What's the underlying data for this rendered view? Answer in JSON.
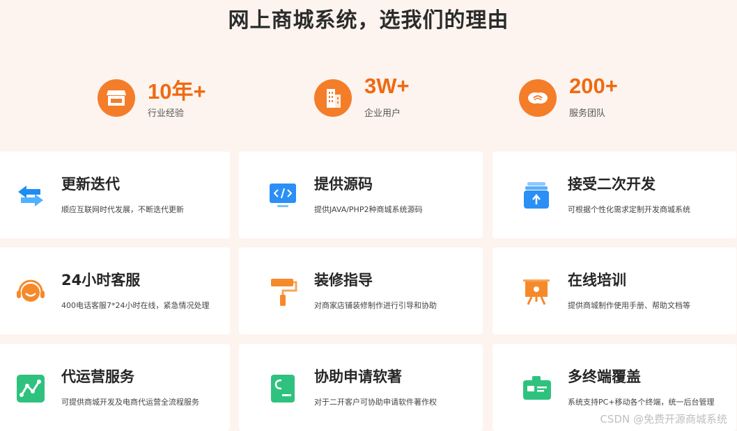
{
  "header": {
    "title": "网上商城系统，选我们的理由"
  },
  "stats": [
    {
      "number": "10年+",
      "label": "行业经验",
      "icon": "store-icon"
    },
    {
      "number": "3W+",
      "label": "企业用户",
      "icon": "building-icon"
    },
    {
      "number": "200+",
      "label": "服务团队",
      "icon": "handshake-icon"
    }
  ],
  "features": [
    {
      "title": "更新迭代",
      "desc": "顺应互联网时代发展，不断迭代更新",
      "icon": "swap-arrows-icon"
    },
    {
      "title": "提供源码",
      "desc": "提供JAVA/PHP2种商城系统源码",
      "icon": "code-monitor-icon"
    },
    {
      "title": "接受二次开发",
      "desc": "可根据个性化需求定制开发商城系统",
      "icon": "upload-box-icon"
    },
    {
      "title": "24小时客服",
      "desc": "400电话客服7*24小时在线，紧急情况处理",
      "icon": "headset-icon"
    },
    {
      "title": "装修指导",
      "desc": "对商家店铺装修制作进行引导和协助",
      "icon": "paint-roller-icon"
    },
    {
      "title": "在线培训",
      "desc": "提供商城制作使用手册、帮助文档等",
      "icon": "presentation-board-icon"
    },
    {
      "title": "代运营服务",
      "desc": "可提供商城开发及电商代运营全流程服务",
      "icon": "trend-chart-icon"
    },
    {
      "title": "协助申请软著",
      "desc": "对于二开客户可协助申请软件著作权",
      "icon": "copyright-doc-icon"
    },
    {
      "title": "多终端覆盖",
      "desc": "系统支持PC+移动各个终端，统一后台管理",
      "icon": "id-card-icon"
    }
  ],
  "watermark": "CSDN @免费开源商城系统",
  "colors": {
    "accent": "#ee6a12",
    "blue": "#2b8ff5",
    "orange": "#f6892a",
    "green": "#2fc27f"
  }
}
